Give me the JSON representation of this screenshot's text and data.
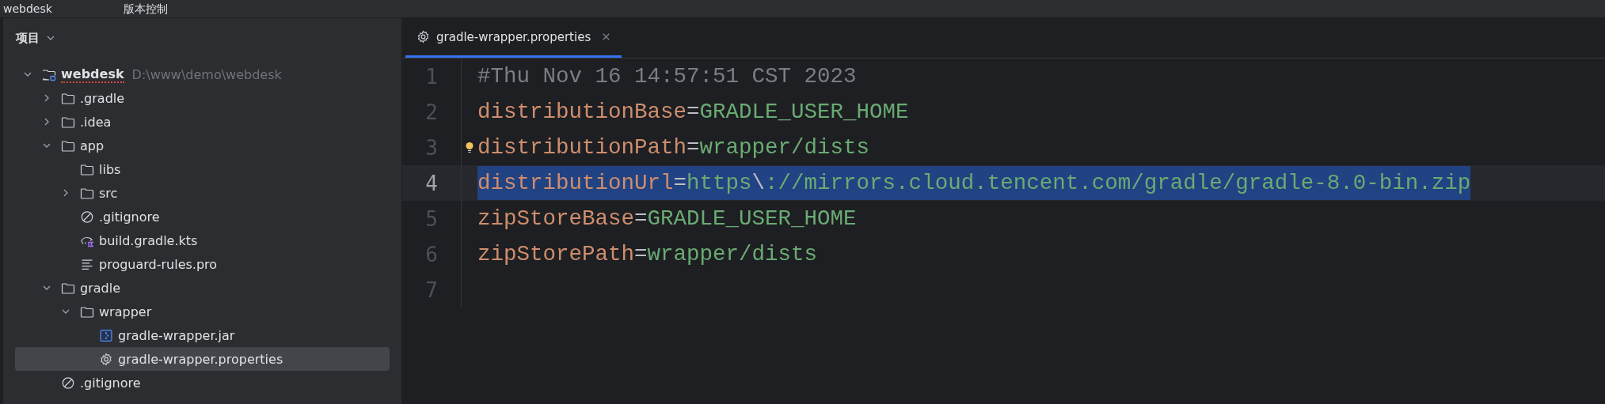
{
  "title_bar": {
    "project": "webdesk",
    "menu": "版本控制"
  },
  "sidebar": {
    "title": "项目",
    "tree": [
      {
        "label": "webdesk",
        "path": "D:\\www\\demo\\webdesk",
        "kind": "module",
        "expanded": true,
        "error": true,
        "selected": false,
        "children": [
          {
            "label": ".gradle",
            "kind": "folder",
            "expanded": false,
            "selected": false
          },
          {
            "label": ".idea",
            "kind": "folder",
            "expanded": false,
            "selected": false
          },
          {
            "label": "app",
            "kind": "folder",
            "expanded": true,
            "selected": false,
            "children": [
              {
                "label": "libs",
                "kind": "folder",
                "selected": false
              },
              {
                "label": "src",
                "kind": "folder",
                "expanded": false,
                "selected": false
              },
              {
                "label": ".gitignore",
                "kind": "ignore",
                "selected": false
              },
              {
                "label": "build.gradle.kts",
                "kind": "gradle",
                "selected": false
              },
              {
                "label": "proguard-rules.pro",
                "kind": "text",
                "selected": false
              }
            ]
          },
          {
            "label": "gradle",
            "kind": "folder",
            "expanded": true,
            "selected": false,
            "children": [
              {
                "label": "wrapper",
                "kind": "folder",
                "expanded": true,
                "selected": false,
                "children": [
                  {
                    "label": "gradle-wrapper.jar",
                    "kind": "jar",
                    "selected": false
                  },
                  {
                    "label": "gradle-wrapper.properties",
                    "kind": "gear",
                    "selected": true
                  }
                ]
              }
            ]
          },
          {
            "label": ".gitignore",
            "kind": "ignore",
            "selected": false
          }
        ]
      }
    ]
  },
  "editor": {
    "tabs": [
      {
        "label": "gradle-wrapper.properties",
        "selected": true
      }
    ],
    "lines": [
      {
        "number": "1",
        "selected": false,
        "bulb": false,
        "tokens": [
          {
            "kind": "comment",
            "text": "#Thu Nov 16 14:57:51 CST 2023"
          }
        ]
      },
      {
        "number": "2",
        "selected": false,
        "bulb": false,
        "tokens": [
          {
            "kind": "key",
            "text": "distributionBase"
          },
          {
            "kind": "op",
            "text": "="
          },
          {
            "kind": "value",
            "text": "GRADLE_USER_HOME"
          }
        ]
      },
      {
        "number": "3",
        "selected": false,
        "bulb": true,
        "tokens": [
          {
            "kind": "key",
            "text": "distributionPath"
          },
          {
            "kind": "op",
            "text": "="
          },
          {
            "kind": "value",
            "text": "wrapper/dists"
          }
        ]
      },
      {
        "number": "4",
        "selected": true,
        "bulb": false,
        "tokens": [
          {
            "kind": "key",
            "text": "distributionUrl"
          },
          {
            "kind": "op",
            "text": "="
          },
          {
            "kind": "value",
            "text": "https"
          },
          {
            "kind": "escape",
            "text": "\\"
          },
          {
            "kind": "value",
            "text": "://mirrors.cloud.tencent.com/gradle/gradle-8.0-bin.zip"
          }
        ]
      },
      {
        "number": "5",
        "selected": false,
        "bulb": false,
        "tokens": [
          {
            "kind": "key",
            "text": "zipStoreBase"
          },
          {
            "kind": "op",
            "text": "="
          },
          {
            "kind": "value",
            "text": "GRADLE_USER_HOME"
          }
        ]
      },
      {
        "number": "6",
        "selected": false,
        "bulb": false,
        "tokens": [
          {
            "kind": "key",
            "text": "zipStorePath"
          },
          {
            "kind": "op",
            "text": "="
          },
          {
            "kind": "value",
            "text": "wrapper/dists"
          }
        ]
      },
      {
        "number": "7",
        "selected": false,
        "bulb": false
      }
    ]
  }
}
